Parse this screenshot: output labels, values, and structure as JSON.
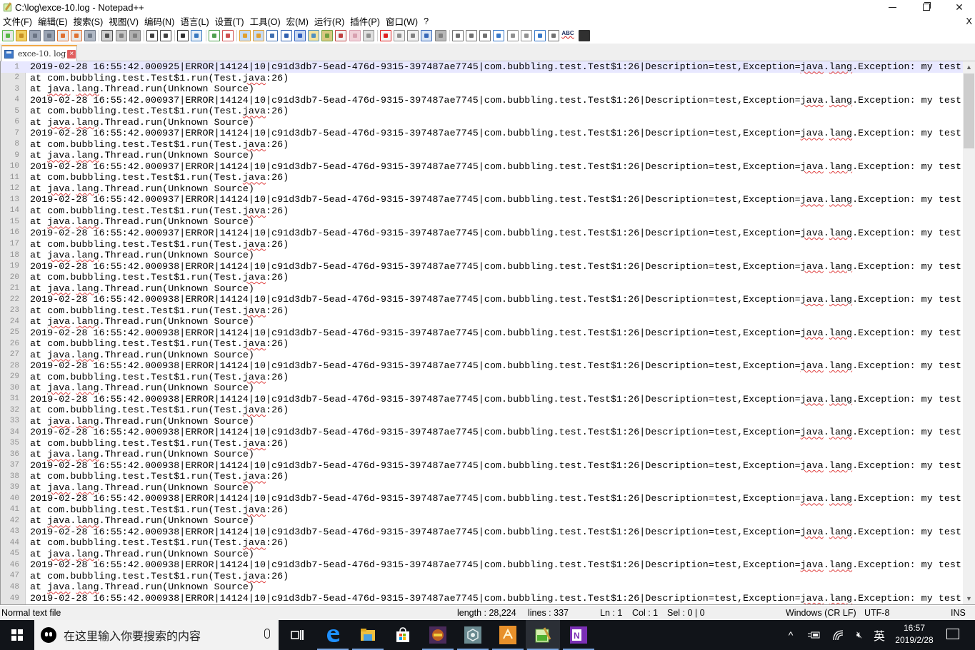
{
  "window": {
    "title": "C:\\log\\exce-10.log - Notepad++",
    "minimize_icon": "minimize-icon",
    "maximize_icon": "restore-icon",
    "close_icon": "close-icon"
  },
  "menu": {
    "items": [
      "文件(F)",
      "编辑(E)",
      "搜索(S)",
      "视图(V)",
      "编码(N)",
      "语言(L)",
      "设置(T)",
      "工具(O)",
      "宏(M)",
      "运行(R)",
      "插件(P)",
      "窗口(W)",
      "?"
    ],
    "close_document": "X"
  },
  "toolbar": {
    "buttons": [
      {
        "name": "new-file-icon",
        "color": "#e8e8e8",
        "accent": "#58b848"
      },
      {
        "name": "open-file-icon",
        "color": "#f0d060",
        "accent": "#c89020"
      },
      {
        "name": "save-icon",
        "color": "#9aa4b4",
        "accent": "#6a7484"
      },
      {
        "name": "save-all-icon",
        "color": "#9aa4b4",
        "accent": "#6a7484"
      },
      {
        "name": "close-file-icon",
        "color": "#e8e8e8",
        "accent": "#e07030"
      },
      {
        "name": "close-all-icon",
        "color": "#e8e8e8",
        "accent": "#e07030"
      },
      {
        "name": "print-icon",
        "color": "#b0b8c4",
        "accent": "#707a88"
      },
      {
        "sep": true
      },
      {
        "name": "cut-icon",
        "color": "#d0d0d0",
        "accent": "#505050"
      },
      {
        "name": "copy-icon",
        "color": "#c8c8c8",
        "accent": "#808080"
      },
      {
        "name": "paste-icon",
        "color": "#b0b0b0",
        "accent": "#808080"
      },
      {
        "sep": true
      },
      {
        "name": "undo-icon",
        "color": "#ffffff",
        "accent": "#404040"
      },
      {
        "name": "redo-icon",
        "color": "#ffffff",
        "accent": "#404040"
      },
      {
        "sep": true
      },
      {
        "name": "find-icon",
        "color": "#ffffff",
        "accent": "#303030"
      },
      {
        "name": "replace-icon",
        "color": "#e8f0f8",
        "accent": "#3878c0"
      },
      {
        "sep": true
      },
      {
        "name": "zoom-in-icon",
        "color": "#ffffff",
        "accent": "#50a050"
      },
      {
        "name": "zoom-out-icon",
        "color": "#ffffff",
        "accent": "#d05050"
      },
      {
        "sep": true
      },
      {
        "name": "sync-vertical-icon",
        "color": "#c8dcf4",
        "accent": "#e0a030"
      },
      {
        "name": "sync-horizontal-icon",
        "color": "#c8dcf4",
        "accent": "#e0a030"
      },
      {
        "name": "word-wrap-icon",
        "color": "#ffffff",
        "accent": "#4070b0"
      },
      {
        "name": "show-all-chars-icon",
        "color": "#ffffff",
        "accent": "#3060b0"
      },
      {
        "name": "indent-guide-icon",
        "color": "#c8d8f0",
        "accent": "#3060c0"
      },
      {
        "name": "document-map-icon",
        "color": "#f4e4a0",
        "accent": "#5090c0"
      },
      {
        "name": "function-list-icon",
        "color": "#d8c880",
        "accent": "#70a040"
      },
      {
        "name": "folder-as-workspace-icon",
        "color": "#f4f4f4",
        "accent": "#c04040"
      },
      {
        "name": "monitoring-icon",
        "color": "#f0d0d8",
        "accent": "#d8a0b0"
      },
      {
        "name": "eye-icon",
        "color": "#e0e0e0",
        "accent": "#909090"
      },
      {
        "sep": true
      },
      {
        "name": "record-macro-icon",
        "color": "#f4f4f4",
        "accent": "#e02020"
      },
      {
        "name": "stop-record-icon",
        "color": "#f0f0f0",
        "accent": "#909090"
      },
      {
        "name": "playback-macro-icon",
        "color": "#f0f0f0",
        "accent": "#808080"
      },
      {
        "name": "run-macro-multiple-icon",
        "color": "#d8e4f4",
        "accent": "#3868b8"
      },
      {
        "name": "save-macro-icon",
        "color": "#b8b8b8",
        "accent": "#808080"
      },
      {
        "sep": true
      },
      {
        "name": "plugin-icon-1",
        "color": "#ffffff",
        "accent": "#707070"
      },
      {
        "name": "plugin-icon-2",
        "color": "#ffffff",
        "accent": "#707070"
      },
      {
        "name": "plugin-icon-3",
        "color": "#ffffff",
        "accent": "#707070"
      },
      {
        "name": "plugin-icon-4",
        "color": "#ffffff",
        "accent": "#3878c8"
      },
      {
        "name": "plugin-icon-5",
        "color": "#ffffff",
        "accent": "#909090"
      },
      {
        "name": "plugin-icon-6",
        "color": "#ffffff",
        "accent": "#909090"
      },
      {
        "name": "plugin-icon-7",
        "color": "#ffffff",
        "accent": "#3878c8"
      },
      {
        "name": "plugin-icon-8",
        "color": "#ffffff",
        "accent": "#707070"
      },
      {
        "name": "spell-check-icon",
        "color": "#ffffff",
        "accent": "#d02020",
        "label": "ABC"
      },
      {
        "name": "plugin-icon-9",
        "color": "#303030",
        "accent": "#303030"
      }
    ]
  },
  "tabs": [
    {
      "label": "exce-10. log",
      "close_icon": "close-tab-icon"
    }
  ],
  "editor": {
    "current_line": 1,
    "lines": [
      "2019-02-28 16:55:42.000925|ERROR|14124|10|c91d3db7-5ead-476d-9315-397487ae7745|com.bubbling.test.Test$1:26|Description=test,Exception=java.lang.Exception: my test",
      "at com.bubbling.test.Test$1.run(Test.java:26)",
      "at java.lang.Thread.run(Unknown Source)",
      "2019-02-28 16:55:42.000937|ERROR|14124|10|c91d3db7-5ead-476d-9315-397487ae7745|com.bubbling.test.Test$1:26|Description=test,Exception=java.lang.Exception: my test",
      "at com.bubbling.test.Test$1.run(Test.java:26)",
      "at java.lang.Thread.run(Unknown Source)",
      "2019-02-28 16:55:42.000937|ERROR|14124|10|c91d3db7-5ead-476d-9315-397487ae7745|com.bubbling.test.Test$1:26|Description=test,Exception=java.lang.Exception: my test",
      "at com.bubbling.test.Test$1.run(Test.java:26)",
      "at java.lang.Thread.run(Unknown Source)",
      "2019-02-28 16:55:42.000937|ERROR|14124|10|c91d3db7-5ead-476d-9315-397487ae7745|com.bubbling.test.Test$1:26|Description=test,Exception=java.lang.Exception: my test",
      "at com.bubbling.test.Test$1.run(Test.java:26)",
      "at java.lang.Thread.run(Unknown Source)",
      "2019-02-28 16:55:42.000937|ERROR|14124|10|c91d3db7-5ead-476d-9315-397487ae7745|com.bubbling.test.Test$1:26|Description=test,Exception=java.lang.Exception: my test",
      "at com.bubbling.test.Test$1.run(Test.java:26)",
      "at java.lang.Thread.run(Unknown Source)",
      "2019-02-28 16:55:42.000937|ERROR|14124|10|c91d3db7-5ead-476d-9315-397487ae7745|com.bubbling.test.Test$1:26|Description=test,Exception=java.lang.Exception: my test",
      "at com.bubbling.test.Test$1.run(Test.java:26)",
      "at java.lang.Thread.run(Unknown Source)",
      "2019-02-28 16:55:42.000938|ERROR|14124|10|c91d3db7-5ead-476d-9315-397487ae7745|com.bubbling.test.Test$1:26|Description=test,Exception=java.lang.Exception: my test",
      "at com.bubbling.test.Test$1.run(Test.java:26)",
      "at java.lang.Thread.run(Unknown Source)",
      "2019-02-28 16:55:42.000938|ERROR|14124|10|c91d3db7-5ead-476d-9315-397487ae7745|com.bubbling.test.Test$1:26|Description=test,Exception=java.lang.Exception: my test",
      "at com.bubbling.test.Test$1.run(Test.java:26)",
      "at java.lang.Thread.run(Unknown Source)",
      "2019-02-28 16:55:42.000938|ERROR|14124|10|c91d3db7-5ead-476d-9315-397487ae7745|com.bubbling.test.Test$1:26|Description=test,Exception=java.lang.Exception: my test",
      "at com.bubbling.test.Test$1.run(Test.java:26)",
      "at java.lang.Thread.run(Unknown Source)",
      "2019-02-28 16:55:42.000938|ERROR|14124|10|c91d3db7-5ead-476d-9315-397487ae7745|com.bubbling.test.Test$1:26|Description=test,Exception=java.lang.Exception: my test",
      "at com.bubbling.test.Test$1.run(Test.java:26)",
      "at java.lang.Thread.run(Unknown Source)",
      "2019-02-28 16:55:42.000938|ERROR|14124|10|c91d3db7-5ead-476d-9315-397487ae7745|com.bubbling.test.Test$1:26|Description=test,Exception=java.lang.Exception: my test",
      "at com.bubbling.test.Test$1.run(Test.java:26)",
      "at java.lang.Thread.run(Unknown Source)",
      "2019-02-28 16:55:42.000938|ERROR|14124|10|c91d3db7-5ead-476d-9315-397487ae7745|com.bubbling.test.Test$1:26|Description=test,Exception=java.lang.Exception: my test",
      "at com.bubbling.test.Test$1.run(Test.java:26)",
      "at java.lang.Thread.run(Unknown Source)",
      "2019-02-28 16:55:42.000938|ERROR|14124|10|c91d3db7-5ead-476d-9315-397487ae7745|com.bubbling.test.Test$1:26|Description=test,Exception=java.lang.Exception: my test",
      "at com.bubbling.test.Test$1.run(Test.java:26)",
      "at java.lang.Thread.run(Unknown Source)",
      "2019-02-28 16:55:42.000938|ERROR|14124|10|c91d3db7-5ead-476d-9315-397487ae7745|com.bubbling.test.Test$1:26|Description=test,Exception=java.lang.Exception: my test",
      "at com.bubbling.test.Test$1.run(Test.java:26)",
      "at java.lang.Thread.run(Unknown Source)",
      "2019-02-28 16:55:42.000938|ERROR|14124|10|c91d3db7-5ead-476d-9315-397487ae7745|com.bubbling.test.Test$1:26|Description=test,Exception=java.lang.Exception: my test",
      "at com.bubbling.test.Test$1.run(Test.java:26)",
      "at java.lang.Thread.run(Unknown Source)",
      "2019-02-28 16:55:42.000938|ERROR|14124|10|c91d3db7-5ead-476d-9315-397487ae7745|com.bubbling.test.Test$1:26|Description=test,Exception=java.lang.Exception: my test",
      "at com.bubbling.test.Test$1.run(Test.java:26)",
      "at java.lang.Thread.run(Unknown Source)",
      "2019-02-28 16:55:42.000938|ERROR|14124|10|c91d3db7-5ead-476d-9315-397487ae7745|com.bubbling.test.Test$1:26|Description=test,Exception=java.lang.Exception: my test"
    ],
    "spellcheck_words": [
      "java",
      "lang"
    ],
    "scroll_position_fraction": 0.0
  },
  "statusbar": {
    "file_type": "Normal text file",
    "length": "length : 28,224",
    "lines": "lines : 337",
    "ln": "Ln : 1",
    "col": "Col : 1",
    "sel": "Sel : 0 | 0",
    "eol": "Windows (CR LF)",
    "encoding": "UTF-8",
    "mode": "INS"
  },
  "taskbar": {
    "search_placeholder": "在这里输入你要搜索的内容",
    "apps": [
      {
        "name": "task-view-icon",
        "active": false
      },
      {
        "name": "edge-icon",
        "active": false,
        "underline": true
      },
      {
        "name": "file-explorer-icon",
        "active": false,
        "underline": true
      },
      {
        "name": "store-icon",
        "active": false
      },
      {
        "name": "game-app-icon",
        "active": false,
        "underline": true
      },
      {
        "name": "settings-app-icon",
        "active": false,
        "underline": true
      },
      {
        "name": "app-orange-icon",
        "active": false,
        "underline": true
      },
      {
        "name": "notepadpp-icon",
        "active": true,
        "underline": true
      },
      {
        "name": "onenote-icon",
        "active": false,
        "underline": true
      }
    ],
    "tray": {
      "show_hidden": "^",
      "ime": "英",
      "time": "16:57",
      "date": "2019/2/28"
    }
  }
}
